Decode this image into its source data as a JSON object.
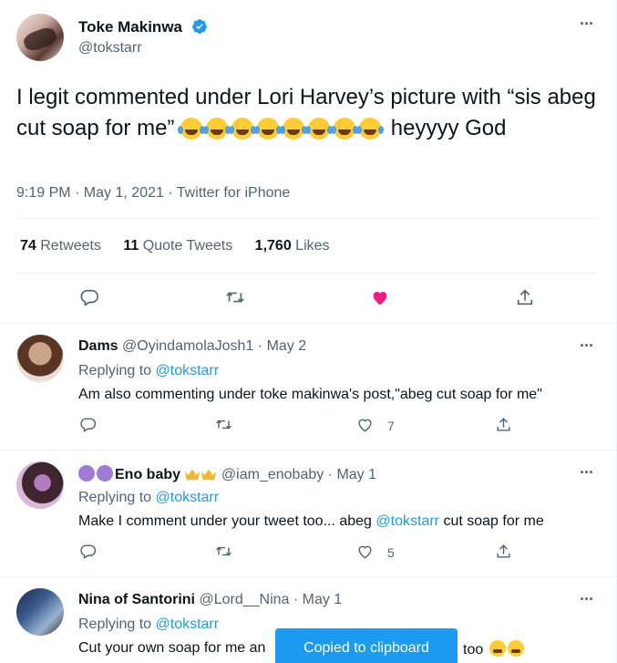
{
  "main_tweet": {
    "author_name": "Toke Makinwa",
    "author_handle": "@tokstarr",
    "text_part1": "I legit commented under Lori Harvey’s picture with “sis abeg cut soap for me”",
    "emoji_count_label": "",
    "text_part2": "heyyyy God",
    "timestamp": "9:19 PM · May 1, 2021 · Twitter for iPhone",
    "stats": {
      "retweets_value": "74",
      "retweets_label": "Retweets",
      "quotes_value": "11",
      "quotes_label": "Quote Tweets",
      "likes_value": "1,760",
      "likes_label": "Likes"
    },
    "liked": true,
    "colors": {
      "like": "#f91880",
      "link": "#1d9bf0",
      "muted": "#536471"
    }
  },
  "replies": [
    {
      "name": "Dams",
      "handle_date": "@OyindamolaJosh1 · May 2",
      "replying_prefix": "Replying to",
      "replying_to": "@tokstarr",
      "text": "Am also commenting under toke makinwa's post,\"abeg cut soap for me\"",
      "like_count": "7"
    },
    {
      "name": "Eno baby",
      "handle_date": "@iam_enobaby · May 1",
      "replying_prefix": "Replying to",
      "replying_to": "@tokstarr",
      "text_before": "Make I comment under your tweet too... abeg",
      "text_mention": "@tokstarr",
      "text_after": "cut soap for me",
      "like_count": "5"
    },
    {
      "name": "Nina of Santorini",
      "handle_date": "@Lord__Nina · May 1",
      "replying_prefix": "Replying to",
      "replying_to": "@tokstarr",
      "text_before": "Cut your own soap for me an",
      "text_after": "too"
    }
  ],
  "toast": {
    "label": "Copied to clipboard"
  }
}
